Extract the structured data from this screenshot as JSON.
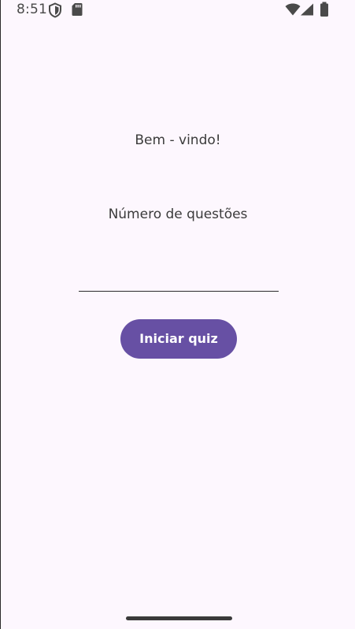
{
  "status_bar": {
    "time": "8:51",
    "icons": [
      "shield-icon",
      "sd-card-icon",
      "wifi-icon",
      "signal-icon",
      "battery-icon"
    ]
  },
  "main": {
    "welcome": "Bem - vindo!",
    "questions_label": "Número de questões",
    "questions_value": "",
    "start_button": "Iniciar quiz"
  },
  "colors": {
    "background": "#fdf7fe",
    "primary": "#6750a4",
    "text": "#3b3b3b"
  }
}
